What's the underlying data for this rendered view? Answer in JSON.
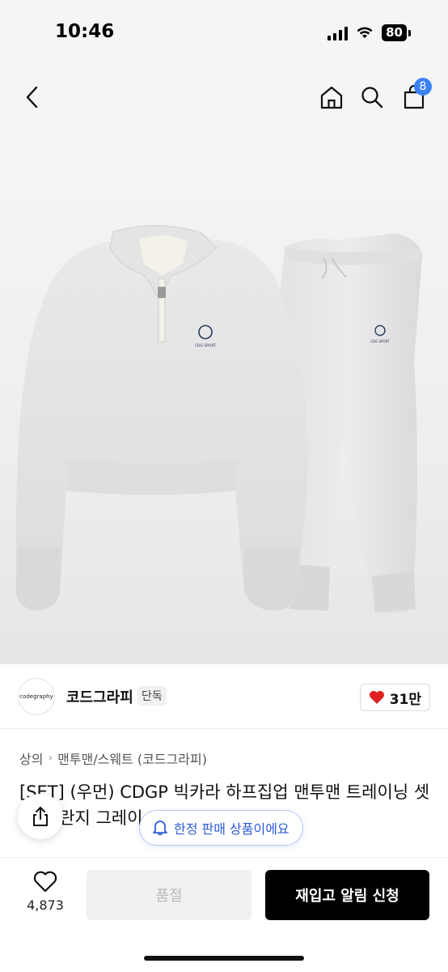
{
  "status_bar": {
    "time": "10:46",
    "battery": "80"
  },
  "nav": {
    "cart_count": "8"
  },
  "product_image": {
    "alt": "",
    "jacket_logo_text": "CDG SPORT",
    "pants_logo_text": "CDG SPORT"
  },
  "brand": {
    "logo_text": "codegraphy",
    "name": "코드그라피",
    "badge": "단독",
    "like_count": "31만",
    "accent_color": "#e02020"
  },
  "breadcrumb": {
    "items": [
      "상의",
      "맨투맨/스웨트 (코드그라피)"
    ]
  },
  "product": {
    "title": "[SET] (우먼) CDGP 빅카라 하프집업 맨투맨 트레이닝 셋업_멜란지 그레이"
  },
  "toast": {
    "limited_label": "한정 판매 상품이에요",
    "color": "#2d5bd6"
  },
  "bottom_bar": {
    "wish_count": "4,873",
    "soldout_label": "품절",
    "restock_label": "재입고 알림 신청"
  },
  "icons": [
    "back-icon",
    "home-icon",
    "search-icon",
    "cart-icon",
    "heart-icon",
    "share-icon",
    "bell-icon"
  ]
}
